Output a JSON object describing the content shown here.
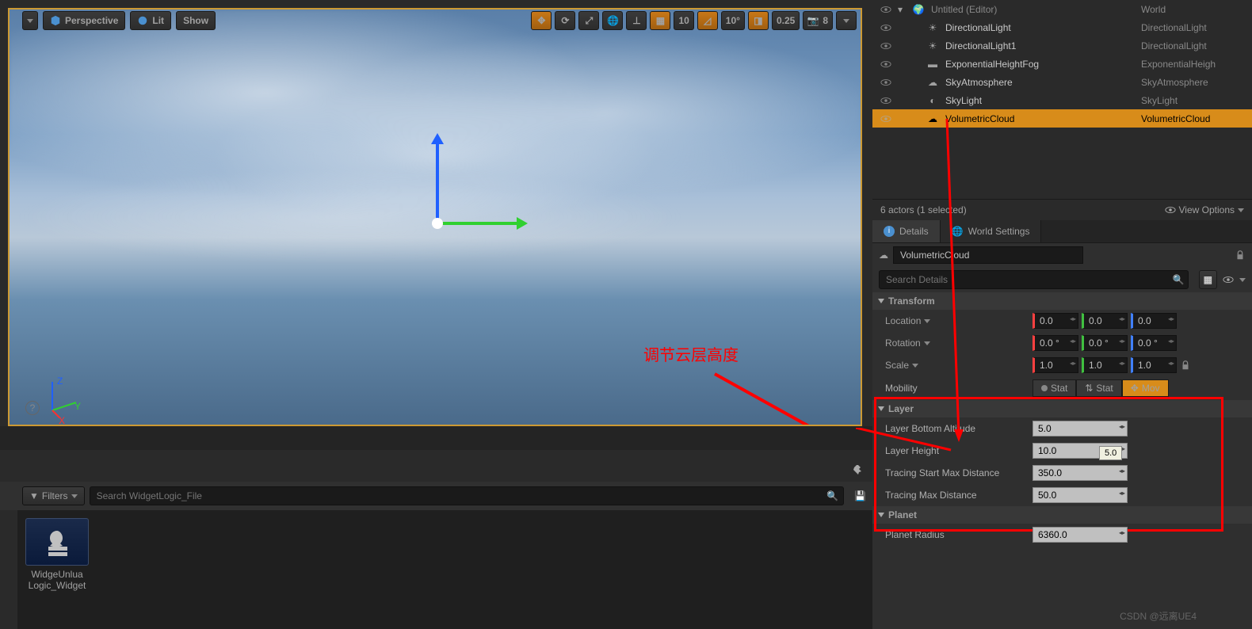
{
  "viewport": {
    "perspective_label": "Perspective",
    "lit_label": "Lit",
    "show_label": "Show",
    "grid_value": "10",
    "angle_value": "10°",
    "scale_value": "0.25",
    "speed_value": "8",
    "annotation": "调节云层高度"
  },
  "outliner": {
    "root": {
      "name": "Untitled (Editor)",
      "type": "World"
    },
    "items": [
      {
        "name": "DirectionalLight",
        "type": "DirectionalLight",
        "icon": "light"
      },
      {
        "name": "DirectionalLight1",
        "type": "DirectionalLight",
        "icon": "light"
      },
      {
        "name": "ExponentialHeightFog",
        "type": "ExponentialHeigh",
        "icon": "fog"
      },
      {
        "name": "SkyAtmosphere",
        "type": "SkyAtmosphere",
        "icon": "atmo"
      },
      {
        "name": "SkyLight",
        "type": "SkyLight",
        "icon": "skylight"
      },
      {
        "name": "VolumetricCloud",
        "type": "VolumetricCloud",
        "icon": "cloud",
        "selected": true
      }
    ],
    "footer_count": "6 actors (1 selected)",
    "view_options": "View Options"
  },
  "details": {
    "tab_details": "Details",
    "tab_world": "World Settings",
    "actor_name": "VolumetricCloud",
    "search_placeholder": "Search Details",
    "transform": {
      "title": "Transform",
      "location": "Location",
      "loc": [
        "0.0",
        "0.0",
        "0.0"
      ],
      "rotation": "Rotation",
      "rot": [
        "0.0 °",
        "0.0 °",
        "0.0 °"
      ],
      "scale": "Scale",
      "scl": [
        "1.0",
        "1.0",
        "1.0"
      ],
      "mobility": "Mobility",
      "mob_stat": "Stat",
      "mob_mov": "Mov"
    },
    "layer": {
      "title": "Layer",
      "bottom_alt_label": "Layer Bottom Altitude",
      "bottom_alt": "5.0",
      "height_label": "Layer Height",
      "height": "10.0",
      "trace_start_label": "Tracing Start Max Distance",
      "trace_start": "350.0",
      "trace_max_label": "Tracing Max Distance",
      "trace_max": "50.0",
      "tooltip": "5.0"
    },
    "planet": {
      "title": "Planet",
      "radius_label": "Planet Radius",
      "radius": "6360.0"
    }
  },
  "content": {
    "filters": "Filters",
    "search_placeholder": "Search WidgetLogic_File",
    "asset": {
      "line1": "WidgeUnlua",
      "line2": "Logic_Widget"
    }
  },
  "watermark": "CSDN @远离UE4",
  "axis": {
    "x": "X",
    "y": "Y",
    "z": "Z"
  }
}
